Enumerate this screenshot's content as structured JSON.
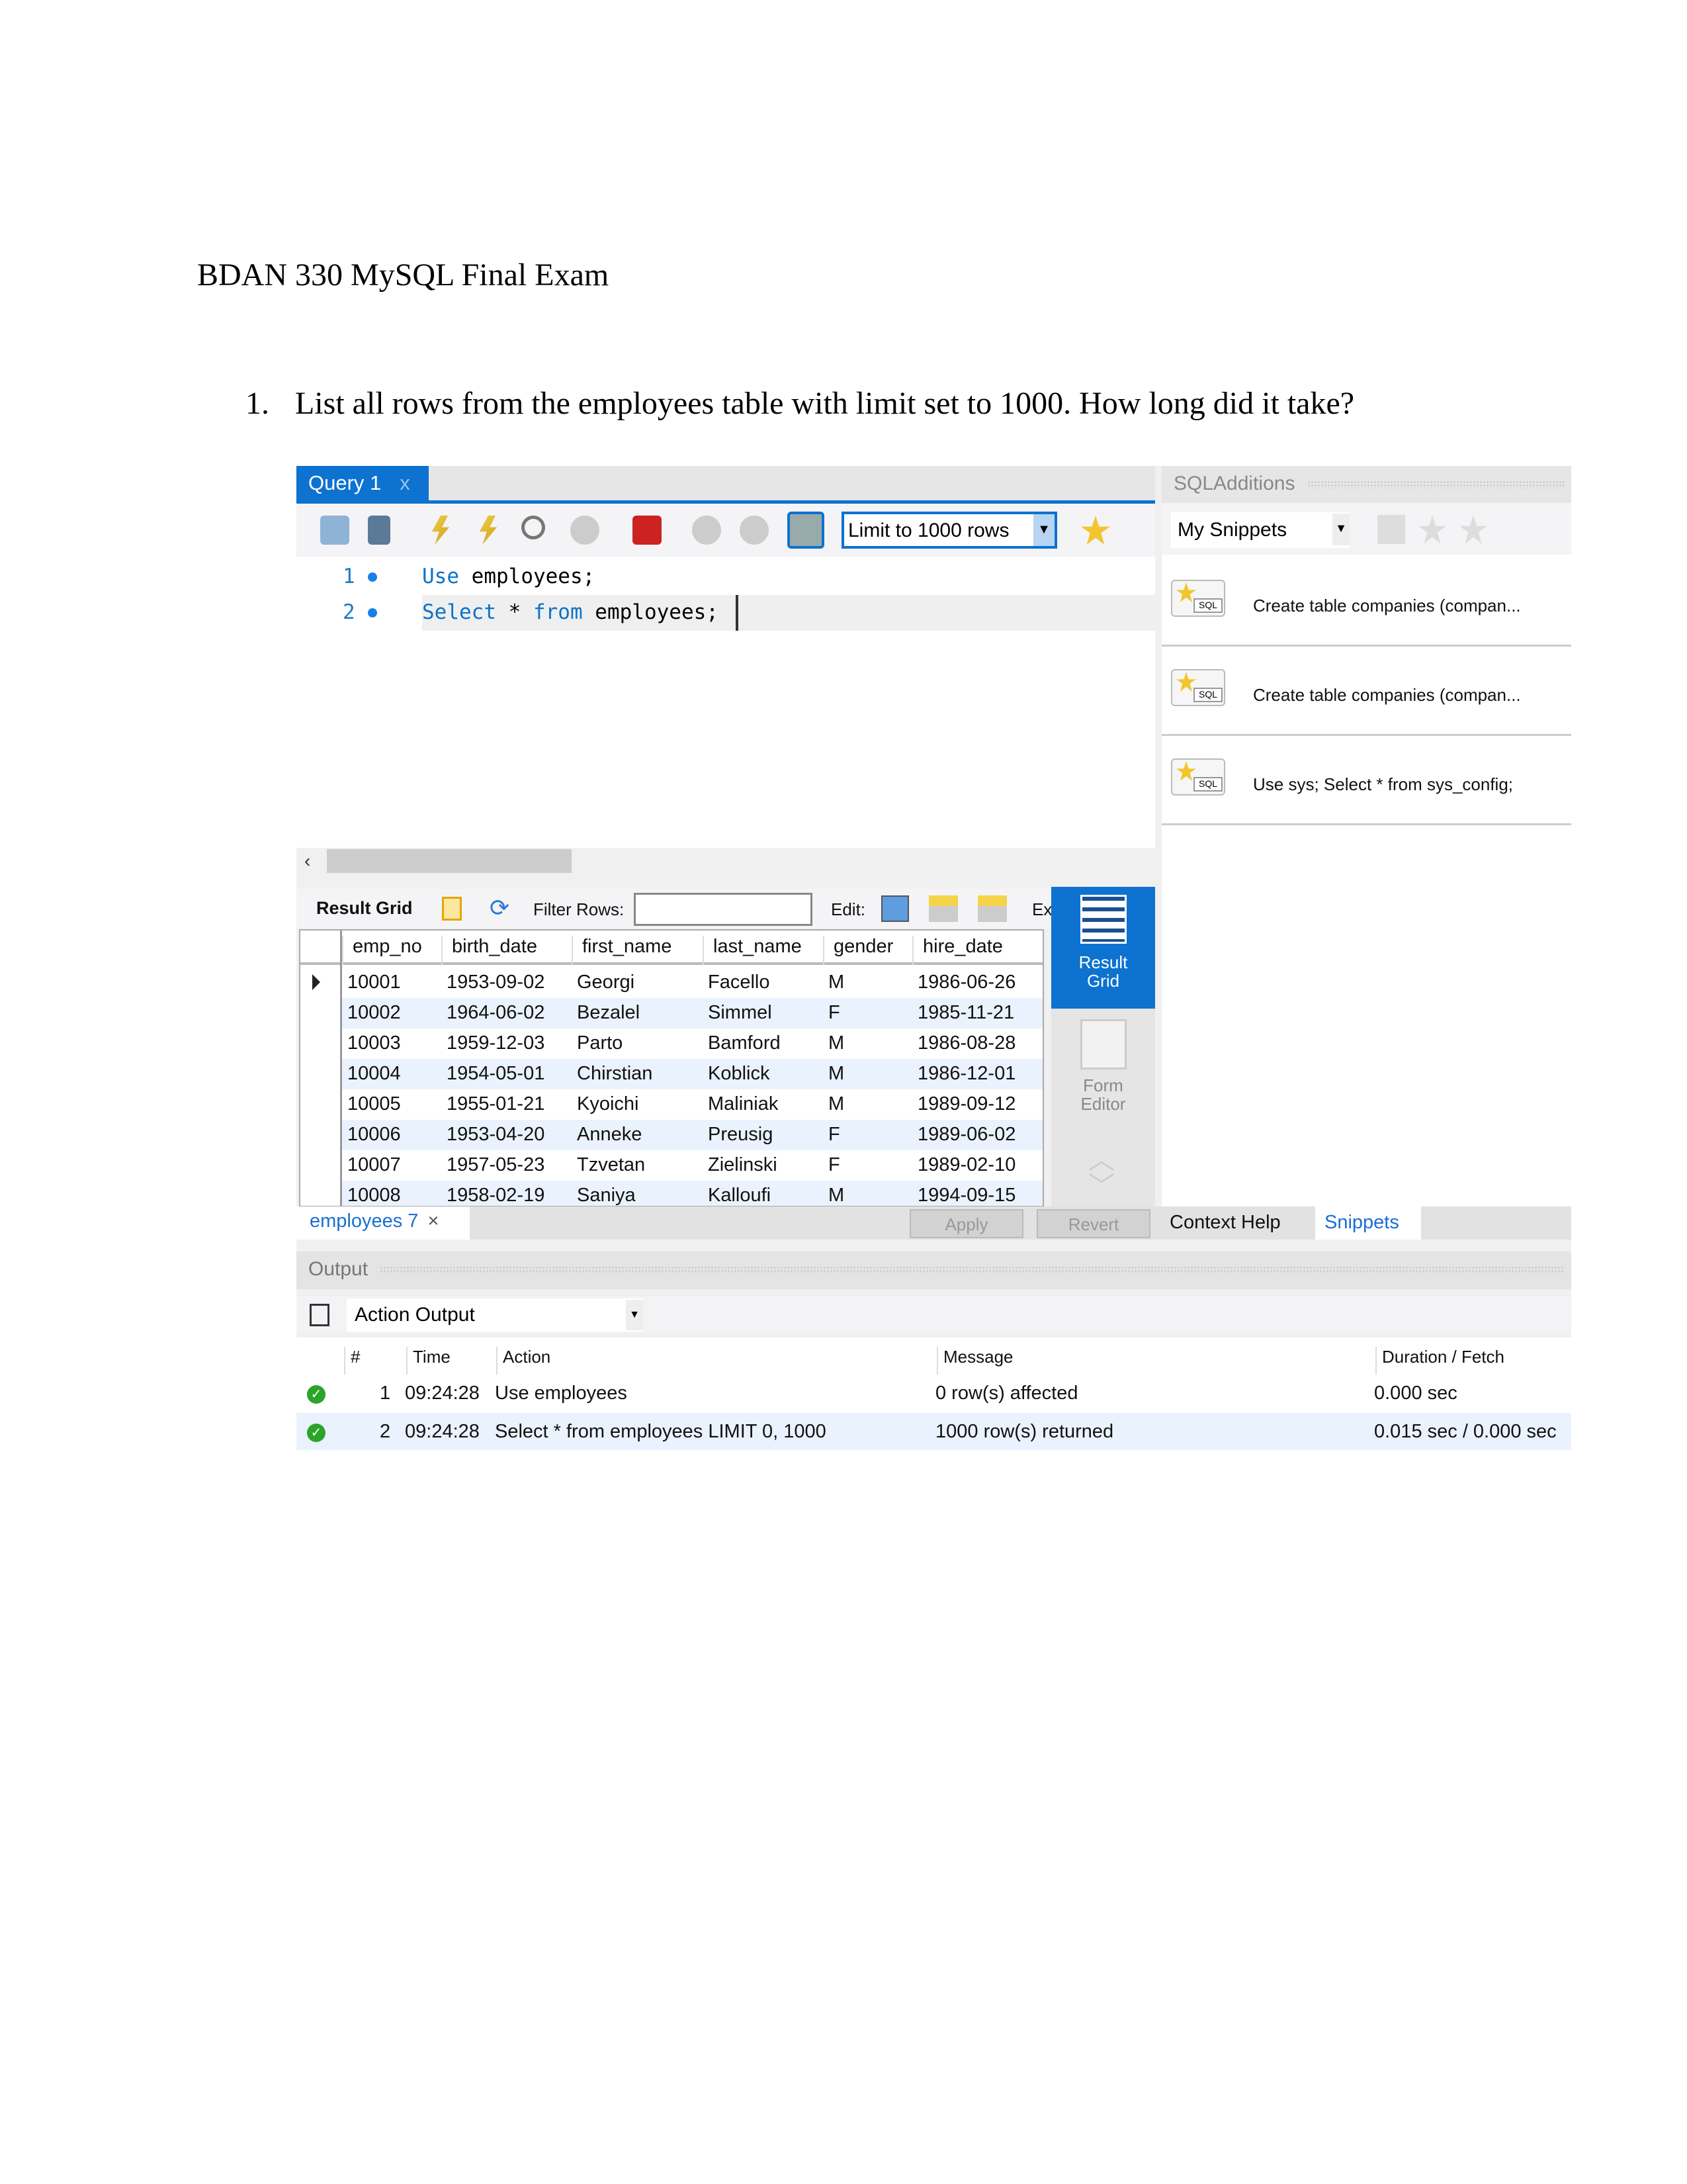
{
  "document": {
    "title": "BDAN 330 MySQL Final Exam",
    "question_number": "1.",
    "question_text": "List all rows from the employees table with limit set to 1000. How long did it take?"
  },
  "editor": {
    "tab_label": "Query 1",
    "tab_close": "x",
    "limit_select": "Limit to 1000 rows",
    "lines": [
      {
        "num": "1",
        "kw1": "Use",
        "rest": " employees;"
      },
      {
        "num": "2",
        "kw1": "Select",
        "mid": " * ",
        "kw2": "from",
        "rest": " employees;"
      }
    ]
  },
  "sql_additions": {
    "title": "SQLAdditions",
    "snippets_select": "My Snippets",
    "snippets": [
      "Create table companies (compan...",
      "Create table companies (compan...",
      "Use sys;  Select * from sys_config;"
    ],
    "tabs": [
      "Context Help",
      "Snippets"
    ]
  },
  "result": {
    "result_grid_label": "Result Grid",
    "filter_label": "Filter Rows:",
    "filter_value": "",
    "edit_label": "Edit:",
    "export_label": "Ex",
    "columns": [
      "emp_no",
      "birth_date",
      "first_name",
      "last_name",
      "gender",
      "hire_date"
    ],
    "rows": [
      [
        "10001",
        "1953-09-02",
        "Georgi",
        "Facello",
        "M",
        "1986-06-26"
      ],
      [
        "10002",
        "1964-06-02",
        "Bezalel",
        "Simmel",
        "F",
        "1985-11-21"
      ],
      [
        "10003",
        "1959-12-03",
        "Parto",
        "Bamford",
        "M",
        "1986-08-28"
      ],
      [
        "10004",
        "1954-05-01",
        "Chirstian",
        "Koblick",
        "M",
        "1986-12-01"
      ],
      [
        "10005",
        "1955-01-21",
        "Kyoichi",
        "Maliniak",
        "M",
        "1989-09-12"
      ],
      [
        "10006",
        "1953-04-20",
        "Anneke",
        "Preusig",
        "F",
        "1989-06-02"
      ],
      [
        "10007",
        "1957-05-23",
        "Tzvetan",
        "Zielinski",
        "F",
        "1989-02-10"
      ],
      [
        "10008",
        "1958-02-19",
        "Saniya",
        "Kalloufi",
        "M",
        "1994-09-15"
      ]
    ],
    "side_result_grid": "Result Grid",
    "side_form_editor": "Form Editor",
    "result_tab": "employees 7",
    "apply": "Apply",
    "revert": "Revert"
  },
  "output": {
    "title": "Output",
    "select": "Action Output",
    "columns": [
      "#",
      "Time",
      "Action",
      "Message",
      "Duration / Fetch"
    ],
    "rows": [
      {
        "num": "1",
        "time": "09:24:28",
        "action": "Use employees",
        "message": "0 row(s) affected",
        "duration": "0.000 sec",
        "status": "success"
      },
      {
        "num": "2",
        "time": "09:24:28",
        "action": "Select * from employees LIMIT 0, 1000",
        "message": "1000 row(s) returned",
        "duration": "0.015 sec / 0.000 sec",
        "status": "success"
      }
    ]
  },
  "colors": {
    "accent": "#0d72d0",
    "success": "#2aa52a",
    "row_alt": "#eaf2fd"
  }
}
